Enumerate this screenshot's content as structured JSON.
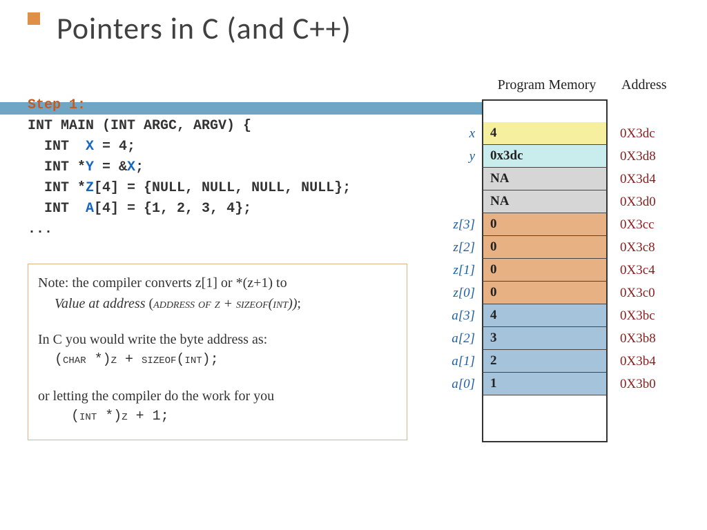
{
  "title": "Pointers in C (and C++)",
  "code": {
    "step": "Step 1:",
    "line1_a": "int main (int argc, argv) {",
    "line2_a": "  int  ",
    "line2_b": "x",
    "line2_c": " = 4;",
    "line3_a": "  int *",
    "line3_b": "y",
    "line3_c": " = &",
    "line3_d": "x",
    "line3_e": ";",
    "line4_a": "  int *",
    "line4_b": "z",
    "line4_c": "[4] = {NULL, NULL, NULL, NULL};",
    "line5_a": "  int  ",
    "line5_b": "a",
    "line5_c": "[4] = {1, 2, 3, 4};",
    "line6": "..."
  },
  "note": {
    "l1": "Note: the compiler converts z[1] or *(z+1) to",
    "l2a": "Value at address",
    "l2b": " (",
    "l2c": "address of z  + sizeof(int))",
    "l2d": ";",
    "l3": "In C you would write the byte address as:",
    "l4": "  (char *)z + sizeof(int);",
    "l5": "or letting the compiler do the work for you",
    "l6": "    (int *)z + 1;"
  },
  "mem_headers": {
    "prog": "Program Memory",
    "addr": "Address"
  },
  "memory": [
    {
      "label": "",
      "value": "",
      "addr": "",
      "color": "c-white",
      "top": true
    },
    {
      "label": "x",
      "value": "4",
      "addr": "0x3dc",
      "color": "c-yellow"
    },
    {
      "label": "y",
      "value": "0x3dc",
      "addr": "0x3d8",
      "color": "c-cyan"
    },
    {
      "label": "",
      "value": "NA",
      "addr": "0x3d4",
      "color": "c-grey"
    },
    {
      "label": "",
      "value": "NA",
      "addr": "0x3d0",
      "color": "c-grey"
    },
    {
      "label": "z[3]",
      "value": "0",
      "addr": "0x3cc",
      "color": "c-orange"
    },
    {
      "label": "z[2]",
      "value": "0",
      "addr": "0x3c8",
      "color": "c-orange"
    },
    {
      "label": "z[1]",
      "value": "0",
      "addr": "0x3c4",
      "color": "c-orange"
    },
    {
      "label": "z[0]",
      "value": "0",
      "addr": "0x3c0",
      "color": "c-orange"
    },
    {
      "label": "a[3]",
      "value": "4",
      "addr": "0x3bc",
      "color": "c-blue"
    },
    {
      "label": "a[2]",
      "value": "3",
      "addr": "0x3b8",
      "color": "c-blue"
    },
    {
      "label": "a[1]",
      "value": "2",
      "addr": "0x3b4",
      "color": "c-blue"
    },
    {
      "label": "a[0]",
      "value": "1",
      "addr": "0x3b0",
      "color": "c-blue"
    },
    {
      "label": "",
      "value": "",
      "addr": "",
      "color": "c-white",
      "bottom": true
    }
  ]
}
